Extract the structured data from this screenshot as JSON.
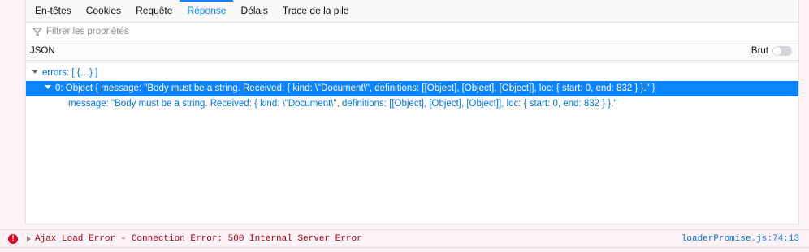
{
  "tabs": [
    {
      "label": "En-têtes",
      "active": false
    },
    {
      "label": "Cookies",
      "active": false
    },
    {
      "label": "Requête",
      "active": false
    },
    {
      "label": "Réponse",
      "active": true
    },
    {
      "label": "Délais",
      "active": false
    },
    {
      "label": "Trace de la pile",
      "active": false
    }
  ],
  "filter": {
    "placeholder": "Filtrer les propriétés",
    "value": "",
    "icon": "filter-icon"
  },
  "json_header": {
    "label": "JSON",
    "raw_label": "Brut",
    "raw_enabled": false
  },
  "tree": {
    "errors_row": "errors: [ {…} ]",
    "item_row": "0: Object { message: \"Body must be a string. Received: { kind: \\\"Document\\\", definitions: [[Object], [Object], [Object]], loc: { start: 0, end: 832 } }.\" }",
    "message_row": "message: \"Body must be a string. Received: { kind: \\\"Document\\\", definitions: [[Object], [Object], [Object]], loc: { start: 0, end: 832 } }.\""
  },
  "console": {
    "icon": "error-icon",
    "message": "Ajax Load Error - Connection Error: 500 Internal Server Error",
    "location": "loaderPromise.js:74:13"
  },
  "colors": {
    "accent": "#0a84ff",
    "error": "#d70022",
    "error_text": "#a4000f",
    "link": "#0074e8"
  }
}
